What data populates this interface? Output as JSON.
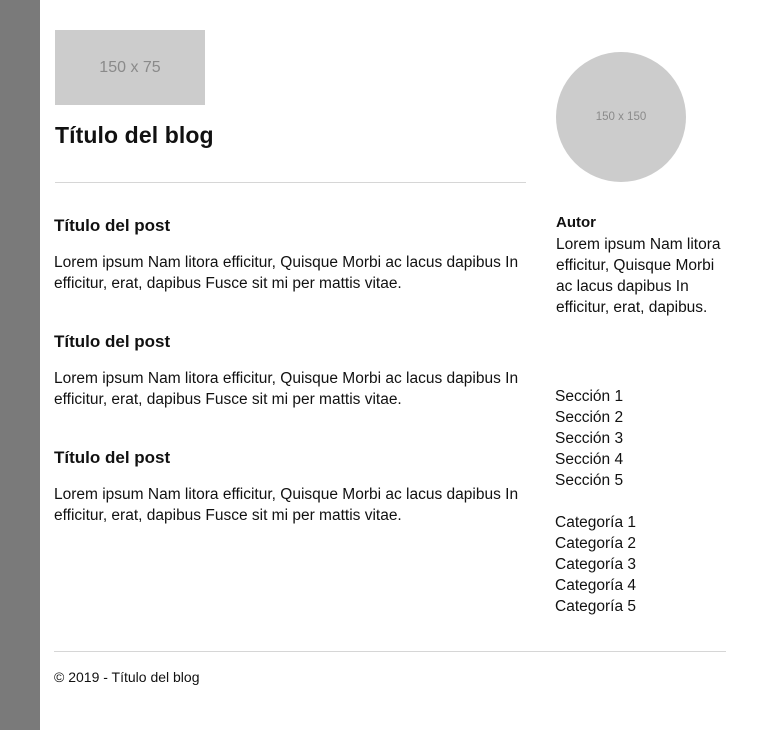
{
  "header": {
    "logo_placeholder": "150 x 75",
    "blog_title": "Título del blog"
  },
  "posts": [
    {
      "title": "Título del post",
      "excerpt": "Lorem ipsum Nam litora efficitur, Quisque Morbi ac lacus dapibus In efficitur, erat, dapibus Fusce sit mi per mattis vitae."
    },
    {
      "title": "Título del post",
      "excerpt": "Lorem ipsum Nam litora efficitur, Quisque Morbi ac lacus dapibus In efficitur, erat, dapibus Fusce sit mi per mattis vitae."
    },
    {
      "title": "Título del post",
      "excerpt": "Lorem ipsum Nam litora efficitur, Quisque Morbi ac lacus dapibus In efficitur, erat, dapibus Fusce sit mi per mattis vitae."
    }
  ],
  "sidebar": {
    "avatar_placeholder": "150 x 150",
    "author_label": "Autor",
    "author_bio": "Lorem ipsum Nam litora efficitur, Quisque Morbi ac lacus dapibus In efficitur, erat, dapibus.",
    "sections": [
      "Sección 1",
      "Sección 2",
      "Sección 3",
      "Sección 4",
      "Sección 5"
    ],
    "categories": [
      "Categoría 1",
      "Categoría 2",
      "Categoría 3",
      "Categoría 4",
      "Categoría 5"
    ]
  },
  "footer": {
    "text": "© 2019 - Título del blog"
  },
  "colors": {
    "side_rail": "#7a7a7a",
    "placeholder": "#cccccc",
    "divider": "#d6d6d6"
  }
}
